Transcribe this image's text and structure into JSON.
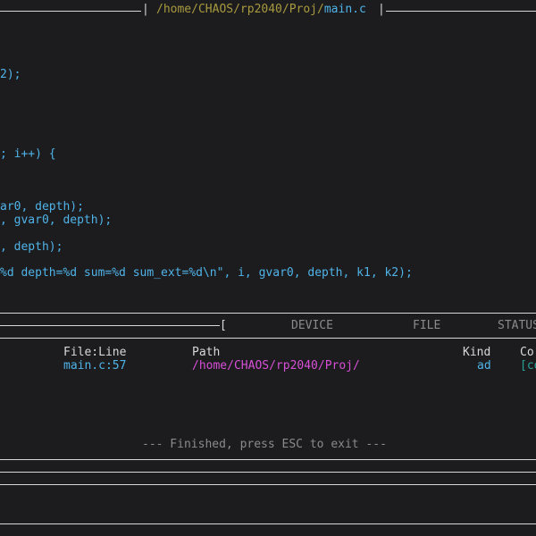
{
  "title_bar": {
    "prefix": "|",
    "path": "/home/CHAOS/rp2040/Proj/",
    "file": "main.c",
    "suffix": "|"
  },
  "code": {
    "lines": [
      "2);",
      "; i++) {",
      "ar0, depth);",
      ", gvar0, depth);",
      ", depth);",
      "%d depth=%d sum=%d sum_ext=%d\\n\", i, gvar0, depth, k1, k2);"
    ]
  },
  "bottom_panel": {
    "tab_bracket": "[",
    "tabs": [
      "DEVICE",
      "FILE",
      "STATUS"
    ],
    "columns": {
      "file_line": "File:Line",
      "path": "Path",
      "kind": "Kind",
      "co": "Co"
    },
    "row": {
      "file_line": "main.c:57",
      "path": "/home/CHAOS/rp2040/Proj/",
      "kind": "ad",
      "co": "[co"
    },
    "status_message": "--- Finished, press ESC to exit ---"
  },
  "colors": {
    "background": "#1c1c1e",
    "code": "#4fb3e8",
    "path_title": "#a89a3e",
    "path_result": "#d64fd6",
    "lines": "#d8d8d8"
  }
}
